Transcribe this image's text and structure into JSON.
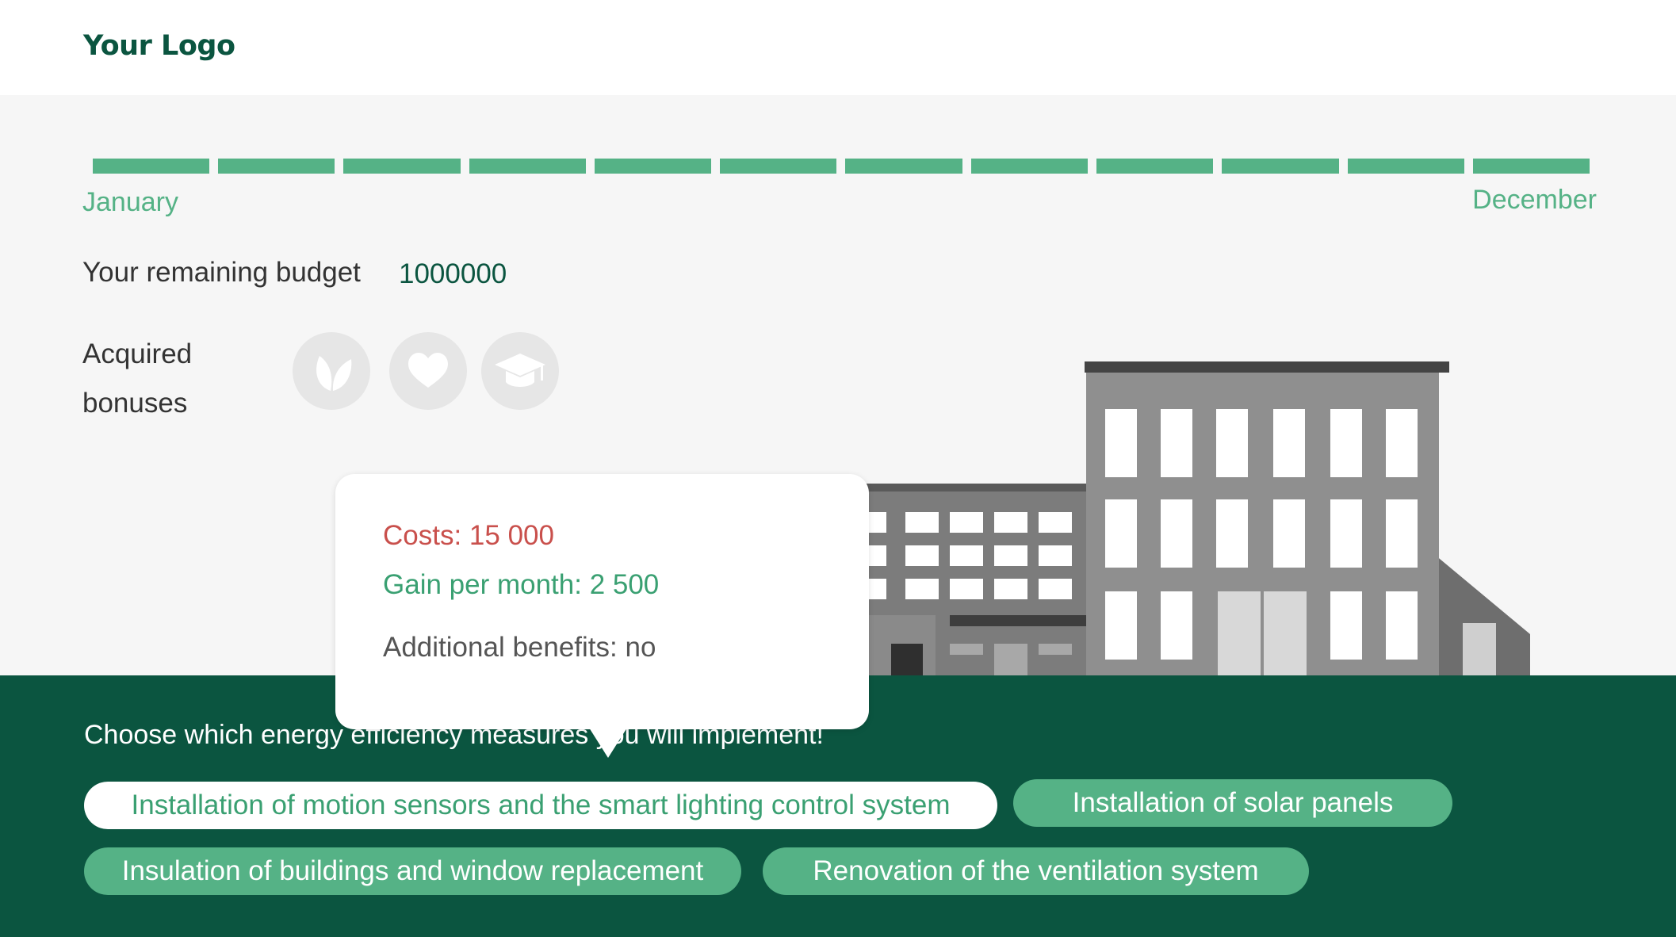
{
  "header": {
    "logo": "Your Logo"
  },
  "timeline": {
    "start_label": "January",
    "end_label": "December",
    "segments_count": 12,
    "color": "#55b286"
  },
  "budget": {
    "label": "Your remaining budget",
    "value": "1000000"
  },
  "bonuses": {
    "label_line1": "Acquired",
    "label_line2": "bonuses",
    "icons": [
      "leaf-icon",
      "heart-icon",
      "graduation-cap-icon"
    ]
  },
  "tooltip": {
    "costs": "Costs: 15 000",
    "gain": "Gain per month: 2 500",
    "benefits": "Additional benefits: no"
  },
  "measures": {
    "prompt": "Choose which energy efficiency measures you will implement!",
    "options": [
      {
        "label": "Installation of motion sensors and the smart lighting control system",
        "selected": true
      },
      {
        "label": "Installation of solar panels",
        "selected": false
      },
      {
        "label": "Insulation of buildings and window replacement",
        "selected": false
      },
      {
        "label": "Renovation of the ventilation system",
        "selected": false
      }
    ]
  },
  "colors": {
    "brand_dark": "#0b5540",
    "accent_green": "#55b286",
    "cost_red": "#c9504c",
    "background": "#f6f6f6"
  }
}
